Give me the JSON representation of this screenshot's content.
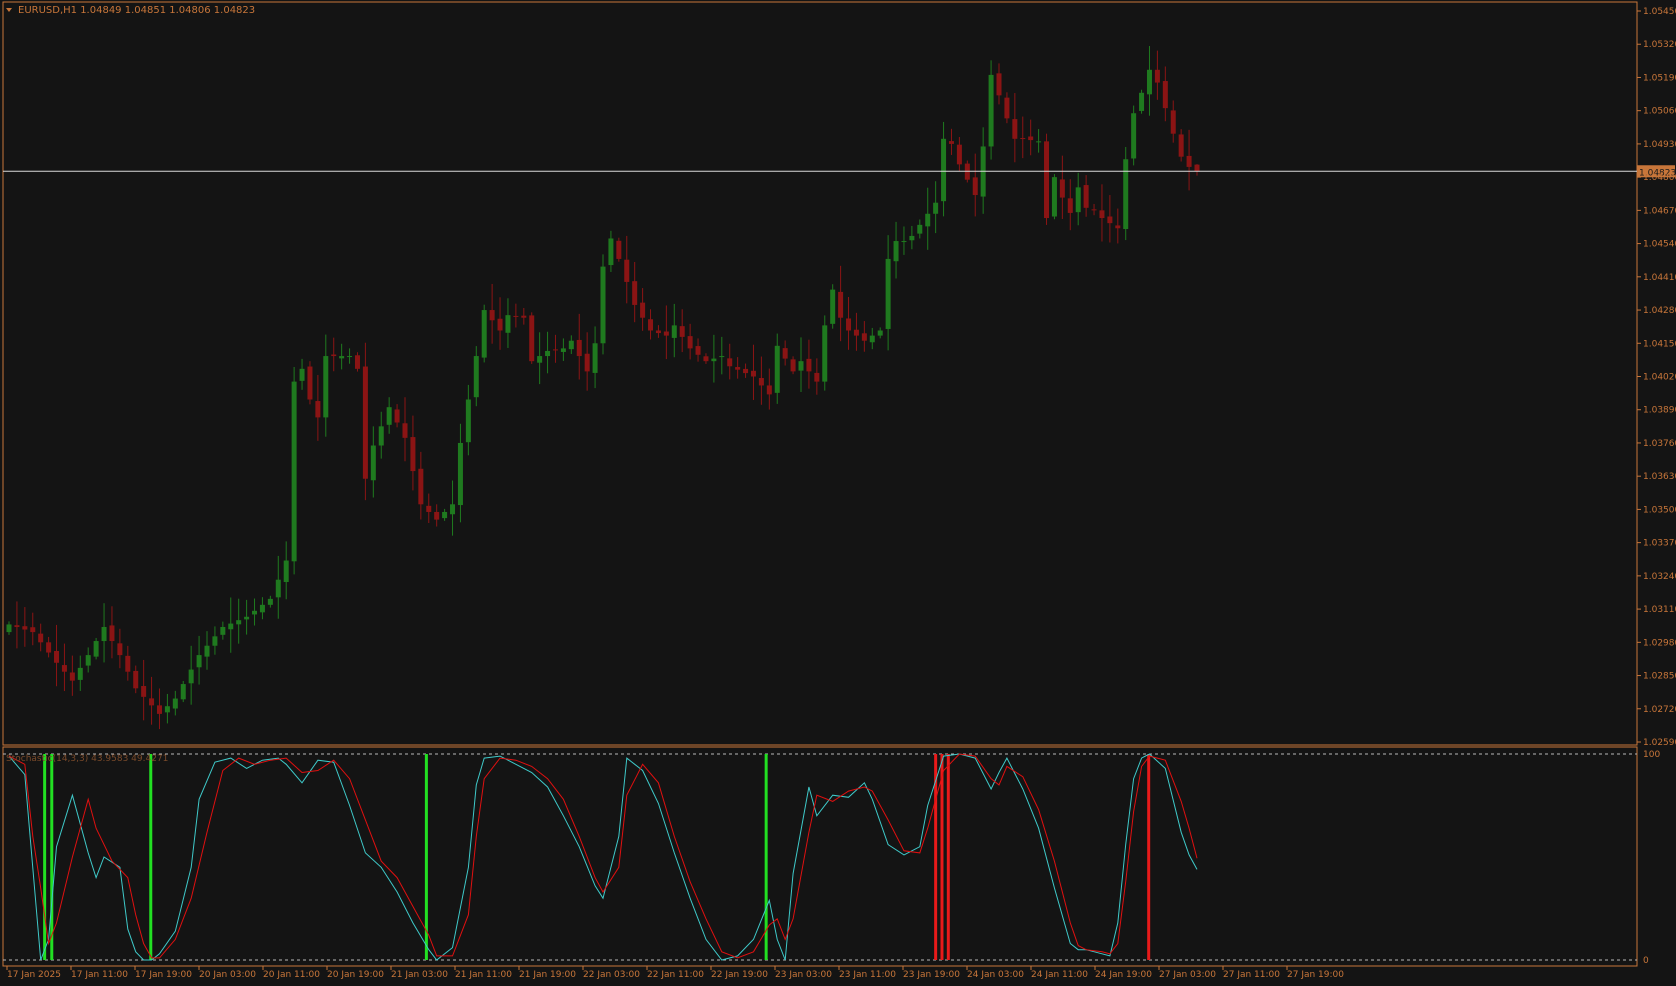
{
  "colors": {
    "background": "#141414",
    "frame": "#c8763a",
    "axis_text": "#c8763a",
    "bull_candle": "#1f7a1f",
    "bear_candle": "#8b1414",
    "current_price_line": "#d9d9d9",
    "price_tag_bg": "#c8763a",
    "stoch_main": "#3fc9c9",
    "stoch_signal": "#e01010",
    "buy_bar": "#22e022",
    "sell_bar": "#e81a1a",
    "level_line": "#b8b8b8"
  },
  "main_header": "EURUSD,H1  1.04849 1.04851 1.04806 1.04823",
  "current_price_label": "1.04823",
  "chart_data": [
    {
      "type": "candlestick",
      "title": "EURUSD,H1",
      "symbol": "EURUSD",
      "timeframe": "H1",
      "ohlc_last": [
        1.04849,
        1.04851,
        1.04806,
        1.04823
      ],
      "current_price": 1.04823,
      "grid": false,
      "ylim": [
        1.0259,
        1.0545
      ],
      "y_ticks": [
        "1.05450",
        "1.05320",
        "1.05190",
        "1.05060",
        "1.04930",
        "1.04800",
        "1.04670",
        "1.04540",
        "1.04410",
        "1.04280",
        "1.04150",
        "1.04020",
        "1.03890",
        "1.03760",
        "1.03630",
        "1.03500",
        "1.03370",
        "1.03240",
        "1.03110",
        "1.02980",
        "1.02850",
        "1.02720",
        "1.02590"
      ],
      "x_ticks": [
        "17 Jan 2025",
        "17 Jan 11:00",
        "17 Jan 19:00",
        "20 Jan 03:00",
        "20 Jan 11:00",
        "20 Jan 19:00",
        "21 Jan 03:00",
        "21 Jan 11:00",
        "21 Jan 19:00",
        "22 Jan 03:00",
        "22 Jan 11:00",
        "22 Jan 19:00",
        "23 Jan 03:00",
        "23 Jan 11:00",
        "23 Jan 19:00",
        "24 Jan 03:00",
        "24 Jan 11:00",
        "24 Jan 19:00",
        "27 Jan 03:00",
        "27 Jan 11:00",
        "27 Jan 19:00"
      ],
      "close_anchors": [
        [
          0,
          1.0305
        ],
        [
          3,
          1.0302
        ],
        [
          6,
          1.029
        ],
        [
          8,
          1.0283
        ],
        [
          10,
          1.0293
        ],
        [
          12,
          1.0304
        ],
        [
          14,
          1.0293
        ],
        [
          16,
          1.028
        ],
        [
          19,
          1.027
        ],
        [
          21,
          1.0276
        ],
        [
          24,
          1.0293
        ],
        [
          27,
          1.0304
        ],
        [
          30,
          1.0308
        ],
        [
          33,
          1.0315
        ],
        [
          35,
          1.033
        ],
        [
          36,
          1.04
        ],
        [
          37,
          1.0405
        ],
        [
          38,
          1.0393
        ],
        [
          39,
          1.0386
        ],
        [
          40,
          1.041
        ],
        [
          43,
          1.041
        ],
        [
          44,
          1.0405
        ],
        [
          45,
          1.0362
        ],
        [
          46,
          1.0375
        ],
        [
          48,
          1.039
        ],
        [
          50,
          1.0378
        ],
        [
          52,
          1.0352
        ],
        [
          54,
          1.0346
        ],
        [
          56,
          1.0352
        ],
        [
          57,
          1.0376
        ],
        [
          59,
          1.041
        ],
        [
          60,
          1.0428
        ],
        [
          62,
          1.042
        ],
        [
          63,
          1.0426
        ],
        [
          65,
          1.0425
        ],
        [
          66,
          1.0408
        ],
        [
          68,
          1.0412
        ],
        [
          70,
          1.0413
        ],
        [
          71,
          1.0416
        ],
        [
          73,
          1.0404
        ],
        [
          74,
          1.0415
        ],
        [
          75,
          1.0445
        ],
        [
          76,
          1.0456
        ],
        [
          77,
          1.0448
        ],
        [
          79,
          1.043
        ],
        [
          81,
          1.042
        ],
        [
          83,
          1.0418
        ],
        [
          84,
          1.0422
        ],
        [
          86,
          1.0413
        ],
        [
          88,
          1.0408
        ],
        [
          90,
          1.041
        ],
        [
          91,
          1.0406
        ],
        [
          94,
          1.0402
        ],
        [
          96,
          1.0395
        ],
        [
          97,
          1.0414
        ],
        [
          99,
          1.0404
        ],
        [
          100,
          1.0408
        ],
        [
          102,
          1.04
        ],
        [
          103,
          1.0422
        ],
        [
          104,
          1.0436
        ],
        [
          105,
          1.0425
        ],
        [
          106,
          1.042
        ],
        [
          108,
          1.0416
        ],
        [
          110,
          1.042
        ],
        [
          111,
          1.0448
        ],
        [
          112,
          1.0455
        ],
        [
          113,
          1.0455
        ],
        [
          114,
          1.0457
        ],
        [
          117,
          1.047
        ],
        [
          118,
          1.0495
        ],
        [
          119,
          1.0493
        ],
        [
          120,
          1.0485
        ],
        [
          122,
          1.0473
        ],
        [
          123,
          1.0492
        ],
        [
          124,
          1.052
        ],
        [
          125,
          1.0512
        ],
        [
          126,
          1.0503
        ],
        [
          127,
          1.0495
        ],
        [
          128,
          1.0495
        ],
        [
          130,
          1.0494
        ],
        [
          131,
          1.0464
        ],
        [
          132,
          1.048
        ],
        [
          133,
          1.0472
        ],
        [
          134,
          1.0466
        ],
        [
          135,
          1.0476
        ],
        [
          136,
          1.0468
        ],
        [
          137,
          1.0467
        ],
        [
          138,
          1.0464
        ],
        [
          139,
          1.0462
        ],
        [
          140,
          1.046
        ],
        [
          141,
          1.0487
        ],
        [
          142,
          1.0505
        ],
        [
          143,
          1.0513
        ],
        [
          144,
          1.0522
        ],
        [
          145,
          1.0517
        ],
        [
          146,
          1.0507
        ],
        [
          147,
          1.0497
        ],
        [
          148,
          1.0488
        ],
        [
          149,
          1.0484
        ],
        [
          150,
          1.04823
        ]
      ]
    },
    {
      "type": "line",
      "title": "Stochastic(14,3,3)",
      "header": "Stochastic(14,3,3) 43.9583 49.4271",
      "series": [
        {
          "name": "Main",
          "last": 43.9583,
          "anchors": [
            [
              0,
              99
            ],
            [
              2,
              90
            ],
            [
              4,
              0
            ],
            [
              5,
              10
            ],
            [
              6,
              55
            ],
            [
              8,
              80
            ],
            [
              10,
              52
            ],
            [
              11,
              40
            ],
            [
              12,
              50
            ],
            [
              14,
              45
            ],
            [
              15,
              15
            ],
            [
              16,
              4
            ],
            [
              17,
              0
            ],
            [
              18,
              0
            ],
            [
              19,
              3
            ],
            [
              21,
              14
            ],
            [
              23,
              45
            ],
            [
              24,
              78
            ],
            [
              26,
              96
            ],
            [
              28,
              98
            ],
            [
              30,
              93
            ],
            [
              32,
              97
            ],
            [
              34,
              98
            ],
            [
              35,
              95
            ],
            [
              37,
              86
            ],
            [
              39,
              97
            ],
            [
              41,
              96
            ],
            [
              43,
              75
            ],
            [
              45,
              52
            ],
            [
              47,
              45
            ],
            [
              49,
              33
            ],
            [
              51,
              18
            ],
            [
              53,
              5
            ],
            [
              54,
              0
            ],
            [
              56,
              6
            ],
            [
              58,
              45
            ],
            [
              59,
              85
            ],
            [
              60,
              98
            ],
            [
              62,
              99
            ],
            [
              64,
              95
            ],
            [
              66,
              91
            ],
            [
              68,
              84
            ],
            [
              70,
              70
            ],
            [
              72,
              55
            ],
            [
              74,
              36
            ],
            [
              75,
              30
            ],
            [
              77,
              60
            ],
            [
              78,
              98
            ],
            [
              80,
              92
            ],
            [
              82,
              76
            ],
            [
              84,
              52
            ],
            [
              86,
              30
            ],
            [
              88,
              10
            ],
            [
              90,
              0
            ],
            [
              92,
              2
            ],
            [
              94,
              10
            ],
            [
              96,
              29
            ],
            [
              97,
              10
            ],
            [
              98,
              0
            ],
            [
              99,
              42
            ],
            [
              101,
              84
            ],
            [
              102,
              70
            ],
            [
              104,
              80
            ],
            [
              106,
              79
            ],
            [
              108,
              86
            ],
            [
              109,
              78
            ],
            [
              111,
              56
            ],
            [
              113,
              51
            ],
            [
              115,
              55
            ],
            [
              116,
              75
            ],
            [
              118,
              99
            ],
            [
              120,
              100
            ],
            [
              122,
              98
            ],
            [
              124,
              83
            ],
            [
              125,
              91
            ],
            [
              126,
              98
            ],
            [
              128,
              83
            ],
            [
              130,
              64
            ],
            [
              132,
              35
            ],
            [
              134,
              8
            ],
            [
              135,
              5
            ],
            [
              136,
              5
            ],
            [
              138,
              3
            ],
            [
              139,
              2
            ],
            [
              140,
              18
            ],
            [
              141,
              56
            ],
            [
              142,
              88
            ],
            [
              143,
              98
            ],
            [
              144,
              100
            ],
            [
              146,
              93
            ],
            [
              148,
              62
            ],
            [
              149,
              51
            ],
            [
              150,
              43.9583
            ]
          ]
        },
        {
          "name": "Signal",
          "last": 49.4271,
          "anchors": [
            [
              0,
              99
            ],
            [
              2,
              95
            ],
            [
              3,
              60
            ],
            [
              4,
              35
            ],
            [
              5,
              8
            ],
            [
              6,
              18
            ],
            [
              8,
              50
            ],
            [
              10,
              78
            ],
            [
              11,
              64
            ],
            [
              13,
              48
            ],
            [
              15,
              40
            ],
            [
              16,
              22
            ],
            [
              17,
              8
            ],
            [
              18,
              1
            ],
            [
              19,
              1
            ],
            [
              21,
              10
            ],
            [
              23,
              30
            ],
            [
              25,
              62
            ],
            [
              27,
              92
            ],
            [
              29,
              98
            ],
            [
              31,
              95
            ],
            [
              33,
              97
            ],
            [
              35,
              98
            ],
            [
              37,
              91
            ],
            [
              39,
              92
            ],
            [
              41,
              97
            ],
            [
              43,
              88
            ],
            [
              45,
              68
            ],
            [
              47,
              48
            ],
            [
              49,
              40
            ],
            [
              51,
              26
            ],
            [
              53,
              12
            ],
            [
              54,
              2
            ],
            [
              56,
              2
            ],
            [
              58,
              22
            ],
            [
              59,
              60
            ],
            [
              60,
              88
            ],
            [
              62,
              98
            ],
            [
              64,
              97
            ],
            [
              66,
              94
            ],
            [
              68,
              88
            ],
            [
              70,
              78
            ],
            [
              72,
              60
            ],
            [
              74,
              40
            ],
            [
              75,
              33
            ],
            [
              77,
              45
            ],
            [
              78,
              80
            ],
            [
              80,
              95
            ],
            [
              82,
              86
            ],
            [
              84,
              60
            ],
            [
              86,
              38
            ],
            [
              88,
              20
            ],
            [
              90,
              4
            ],
            [
              92,
              1
            ],
            [
              94,
              4
            ],
            [
              96,
              17
            ],
            [
              97,
              20
            ],
            [
              98,
              10
            ],
            [
              99,
              20
            ],
            [
              101,
              62
            ],
            [
              102,
              80
            ],
            [
              104,
              77
            ],
            [
              106,
              82
            ],
            [
              108,
              84
            ],
            [
              109,
              82
            ],
            [
              111,
              68
            ],
            [
              113,
              53
            ],
            [
              115,
              52
            ],
            [
              116,
              64
            ],
            [
              118,
              92
            ],
            [
              120,
              100
            ],
            [
              122,
              99
            ],
            [
              124,
              88
            ],
            [
              125,
              85
            ],
            [
              126,
              94
            ],
            [
              128,
              89
            ],
            [
              130,
              73
            ],
            [
              132,
              48
            ],
            [
              134,
              18
            ],
            [
              135,
              7
            ],
            [
              136,
              5
            ],
            [
              138,
              4
            ],
            [
              139,
              3
            ],
            [
              140,
              8
            ],
            [
              141,
              38
            ],
            [
              142,
              72
            ],
            [
              143,
              94
            ],
            [
              144,
              99
            ],
            [
              146,
              97
            ],
            [
              148,
              77
            ],
            [
              149,
              64
            ],
            [
              150,
              49.4271
            ]
          ]
        }
      ],
      "ylim": [
        0,
        100
      ],
      "levels": [
        0,
        20,
        80,
        100
      ],
      "y_ticks": [
        "100",
        "0"
      ],
      "buy_signal_bars": [
        4.5,
        5.4,
        17.9,
        52.7,
        95.6
      ],
      "sell_signal_bars": [
        117,
        117.8,
        118.6,
        143.9
      ]
    }
  ]
}
